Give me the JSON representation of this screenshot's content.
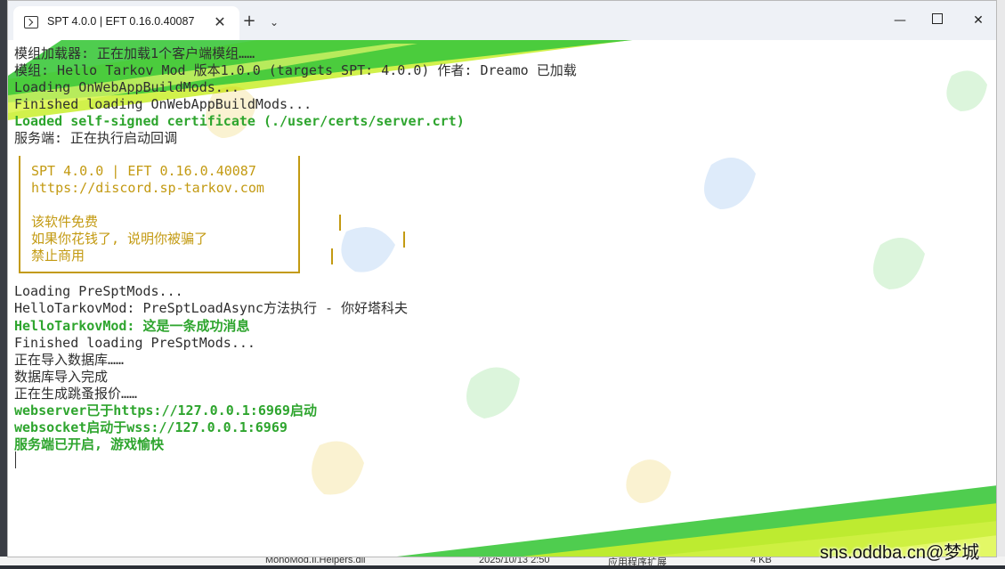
{
  "window": {
    "tab_title": "SPT 4.0.0 | EFT 0.16.0.40087",
    "tab_close": "✕",
    "new_tab": "+",
    "dropdown": "⌄",
    "minimize": "—",
    "close": "✕"
  },
  "terminal": {
    "lines": [
      {
        "text": "模组加载器: 正在加载1个客户端模组……",
        "color": "dark"
      },
      {
        "text": "模组: Hello Tarkov Mod 版本1.0.0 (targets SPT: 4.0.0) 作者: Dreamo 已加载",
        "color": "dark"
      },
      {
        "text": "Loading OnWebAppBuildMods...",
        "color": "dark"
      },
      {
        "text": "Finished loading OnWebAppBuildMods...",
        "color": "dark"
      },
      {
        "text": "Loaded self-signed certificate (./user/certs/server.crt)",
        "color": "green"
      },
      {
        "text": "服务端: 正在执行启动回调",
        "color": "dark"
      }
    ],
    "banner": [
      "SPT 4.0.0 | EFT 0.16.0.40087",
      "https://discord.sp-tarkov.com",
      "",
      "该软件免费",
      "如果你花钱了, 说明你被骗了",
      "禁止商用"
    ],
    "lines_after": [
      {
        "text": "Loading PreSptMods...",
        "color": "dark"
      },
      {
        "text": "HelloTarkovMod: PreSptLoadAsync方法执行 - 你好塔科夫",
        "color": "dark"
      },
      {
        "text": "HelloTarkovMod: 这是一条成功消息",
        "color": "green"
      },
      {
        "text": "Finished loading PreSptMods...",
        "color": "dark"
      },
      {
        "text": "正在导入数据库……",
        "color": "dark"
      },
      {
        "text": "数据库导入完成",
        "color": "dark"
      },
      {
        "text": "正在生成跳蚤报价……",
        "color": "dark"
      },
      {
        "text": "webserver已于https://127.0.0.1:6969启动",
        "color": "green"
      },
      {
        "text": "websocket启动于wss://127.0.0.1:6969",
        "color": "green"
      },
      {
        "text": "服务端已开启, 游戏愉快",
        "color": "green"
      }
    ]
  },
  "watermark": "sns.oddba.cn@梦城",
  "background_window": {
    "file_name": "MonoMod.Il.Helpers.dll",
    "file_date": "2025/10/13 2:50",
    "file_type": "应用程序扩展",
    "file_size": "4 KB"
  },
  "colors": {
    "green_text": "#2ea52e",
    "gold_text": "#c39a12",
    "dark_text": "#2f2f2f",
    "stripe_green": "#3cc83c",
    "stripe_yellow": "#c9ee2c"
  }
}
